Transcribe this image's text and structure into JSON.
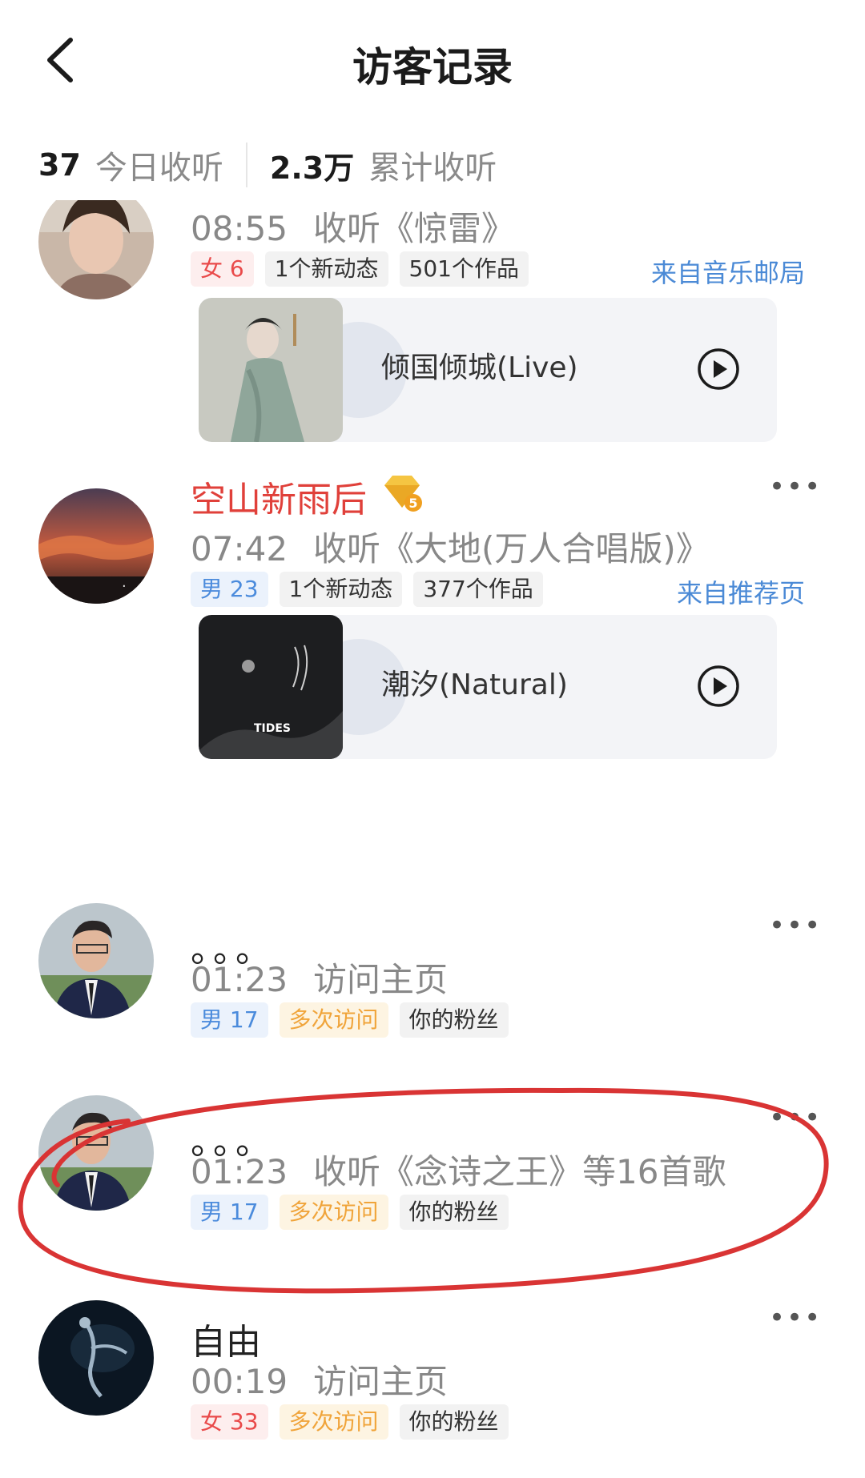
{
  "header": {
    "title": "访客记录"
  },
  "stats": {
    "today_value": "37",
    "today_label": "今日收听",
    "total_value": "2.3万",
    "total_label": "累计收听"
  },
  "visitors": [
    {
      "time": "08:55",
      "action": "收听《惊雷》",
      "tags": [
        "女 6",
        "1个新动态",
        "501个作品"
      ],
      "source": "来自音乐邮局",
      "song": "倾国倾城(Live)"
    },
    {
      "name": "空山新雨后",
      "vip_level": "5",
      "time": "07:42",
      "action": "收听《大地(万人合唱版)》",
      "tags": [
        "男 23",
        "1个新动态",
        "377个作品"
      ],
      "source": "来自推荐页",
      "song": "潮汐(Natural)",
      "cover_text": "TIDES"
    },
    {
      "name": "。。。",
      "time": "01:23",
      "action": "访问主页",
      "tags": [
        "男 17",
        "多次访问",
        "你的粉丝"
      ]
    },
    {
      "name": "。。。",
      "time": "01:23",
      "action": "收听《念诗之王》等16首歌",
      "tags": [
        "男 17",
        "多次访问",
        "你的粉丝"
      ]
    },
    {
      "name": "自由",
      "time": "00:19",
      "action": "访问主页",
      "tags": [
        "女 33",
        "多次访问",
        "你的粉丝"
      ]
    }
  ],
  "more_label": "•••",
  "colors": {
    "accent_red": "#e0403a",
    "link_blue": "#4b8ad6",
    "annotation_red": "#d93434"
  }
}
